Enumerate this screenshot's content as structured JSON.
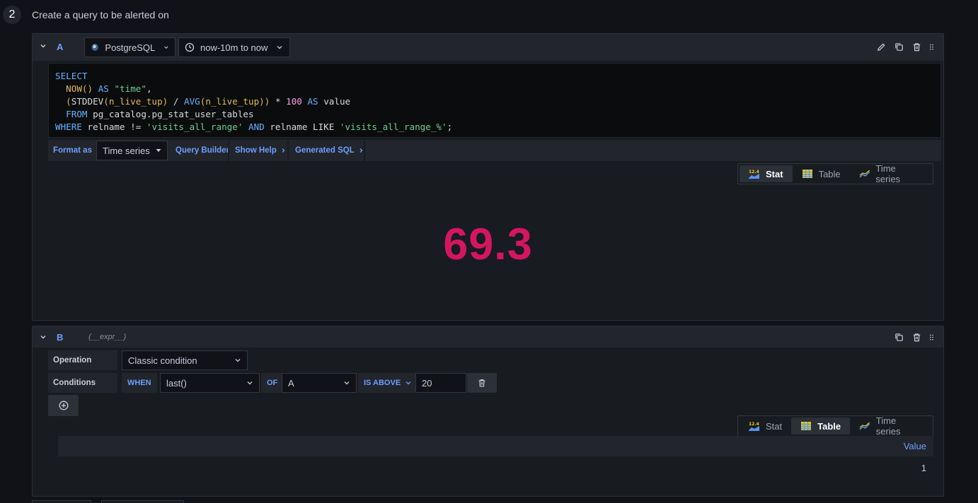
{
  "step": {
    "number": "2",
    "title": "Create a query to be alerted on"
  },
  "query_a": {
    "ref_id": "A",
    "datasource": "PostgreSQL",
    "time_range": "now-10m to now",
    "sql": {
      "line1_kw": "SELECT",
      "line2_fn1": "NOW()",
      "line2_as": "AS",
      "line2_str": "\"time\"",
      "line2_rest": ",",
      "line3_open": "(",
      "line3_fn1": "STDDEV",
      "line3_arg1": "(n_live_tup)",
      "line3_div": " / ",
      "line3_fn2": "AVG",
      "line3_arg2": "(n_live_tup)",
      "line3_close": ")",
      "line3_mul": " * ",
      "line3_num": "100",
      "line3_as": "AS",
      "line3_alias": "value",
      "line4_kw": "FROM",
      "line4_table": "pg_catalog.pg_stat_user_tables",
      "line5_where": "WHERE",
      "line5_col": "relname != ",
      "line5_str1": "'visits_all_range'",
      "line5_and": "AND",
      "line5_col2": "relname LIKE ",
      "line5_str2": "'visits_all_range_%'",
      "line5_end": ";"
    },
    "toolbar": {
      "format_as_label": "Format as",
      "format_value": "Time series",
      "query_builder": "Query Builder",
      "show_help": "Show Help",
      "generated_sql": "Generated SQL"
    },
    "views": {
      "stat": "Stat",
      "table": "Table",
      "time_series": "Time series",
      "active": "Stat"
    },
    "stat_value": "69.3"
  },
  "query_b": {
    "ref_id": "B",
    "expr_note": "(__expr__)",
    "operation_label": "Operation",
    "operation_value": "Classic condition",
    "conditions_label": "Conditions",
    "when_label": "WHEN",
    "reducer": "last()",
    "of_label": "OF",
    "query_ref": "A",
    "evaluator": "IS ABOVE",
    "threshold": "20",
    "views": {
      "stat": "Stat",
      "table": "Table",
      "time_series": "Time series",
      "active": "Table"
    },
    "table": {
      "header": "Value",
      "rows": [
        "1"
      ]
    }
  },
  "icons": {
    "colors": {
      "accent": "#6e9fff",
      "stat_value": "#d4165f",
      "panel_bg": "#181b1f",
      "page_bg": "#111217"
    }
  }
}
